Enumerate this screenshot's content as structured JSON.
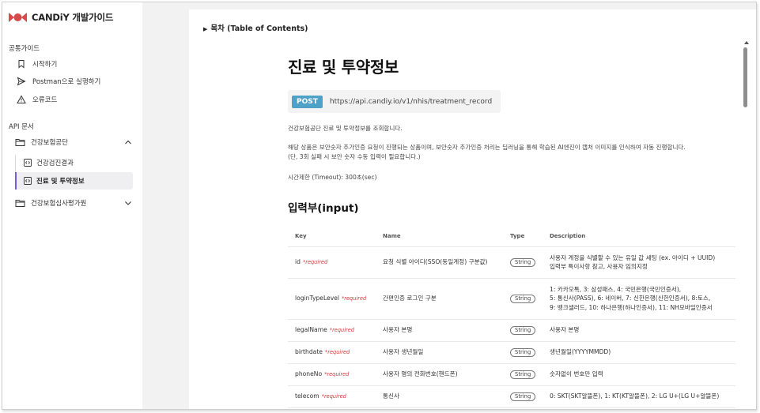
{
  "brand": {
    "name": "CANDiY 개발가이드",
    "logo_icon": "candy-logo-icon",
    "logo_color": "#d84a4a"
  },
  "sidebar": {
    "common_label": "공통가이드",
    "common_items": [
      {
        "label": "시작하기",
        "icon": "bookmark-icon"
      },
      {
        "label": "Postman으로 실행하기",
        "icon": "send-icon"
      },
      {
        "label": "오류코드",
        "icon": "warning-icon"
      }
    ],
    "api_label": "API 문서",
    "groups": [
      {
        "label": "건강보험공단",
        "expanded": true,
        "items": [
          {
            "label": "건강검진결과",
            "active": false
          },
          {
            "label": "진료 및 투약정보",
            "active": true
          }
        ]
      },
      {
        "label": "건강보험심사평가원",
        "expanded": false
      }
    ]
  },
  "main": {
    "toc": "목차 (Table of Contents)",
    "title": "진료 및 투약정보",
    "method": "POST",
    "url": "https://api.candiy.io/v1/nhis/treatment_record",
    "desc1": "건강보험공단 진료 및 투약정보를 조회합니다.",
    "desc2a": "해당 상품은 보안숫자 추가인증 요청이 진행되는 상품이며, 보안숫자 추가인증 처리는 딥러닝을 통해 학습된 AI엔진이 캡처 이미지를 인식하여 자동 진행합니다.",
    "desc2b": "(단, 3회 실패 시 보안 숫자 수동 입력이 필요합니다.)",
    "timeout": "시간제한 (Timeout): 300초(sec)",
    "input_title": "입력부(input)",
    "table": {
      "headers": {
        "key": "Key",
        "name": "Name",
        "type": "Type",
        "desc": "Description"
      },
      "required_label": "*required",
      "rows": [
        {
          "key": "id",
          "name": "요청 식별 아이디(SSO(동일계정) 구분값)",
          "type": "String",
          "desc": [
            "사용자 계정을 식별할 수 있는 유일 값 세팅 (ex. 아이디 + UUID)",
            "입력부 특이사항 참고, 사용자 임의지정"
          ]
        },
        {
          "key": "loginTypeLevel",
          "name": "간편인증 로그인 구분",
          "type": "String",
          "desc": [
            "1: 카카오톡, 3: 삼성패스, 4: 국민은행(국민인증서),",
            "5: 통신사(PASS), 6: 네이버, 7: 신한은행(신한인증서), 8:토스,",
            "9: 뱅크샐러드, 10: 하나은행(하나인증서), 11: NH모바일인증서"
          ]
        },
        {
          "key": "legalName",
          "name": "사용자 본명",
          "type": "String",
          "desc": [
            "사용자 본명"
          ]
        },
        {
          "key": "birthdate",
          "name": "사용자 생년월일",
          "type": "String",
          "desc": [
            "생년월일(YYYYMMDD)"
          ]
        },
        {
          "key": "phoneNo",
          "name": "사용자 명의 전화번호(핸드폰)",
          "type": "String",
          "desc": [
            "숫자없이 번호만 입력"
          ]
        },
        {
          "key": "telecom",
          "name": "통신사",
          "type": "String",
          "desc": [
            "0: SKT(SKT알뜰폰), 1: KT(KT알뜰폰), 2: LG U+(LG U+알뜰폰)"
          ]
        }
      ]
    }
  },
  "colors": {
    "accent": "#7a5bd8",
    "post_badge": "#4fa1c8",
    "required": "#d03b3b"
  }
}
